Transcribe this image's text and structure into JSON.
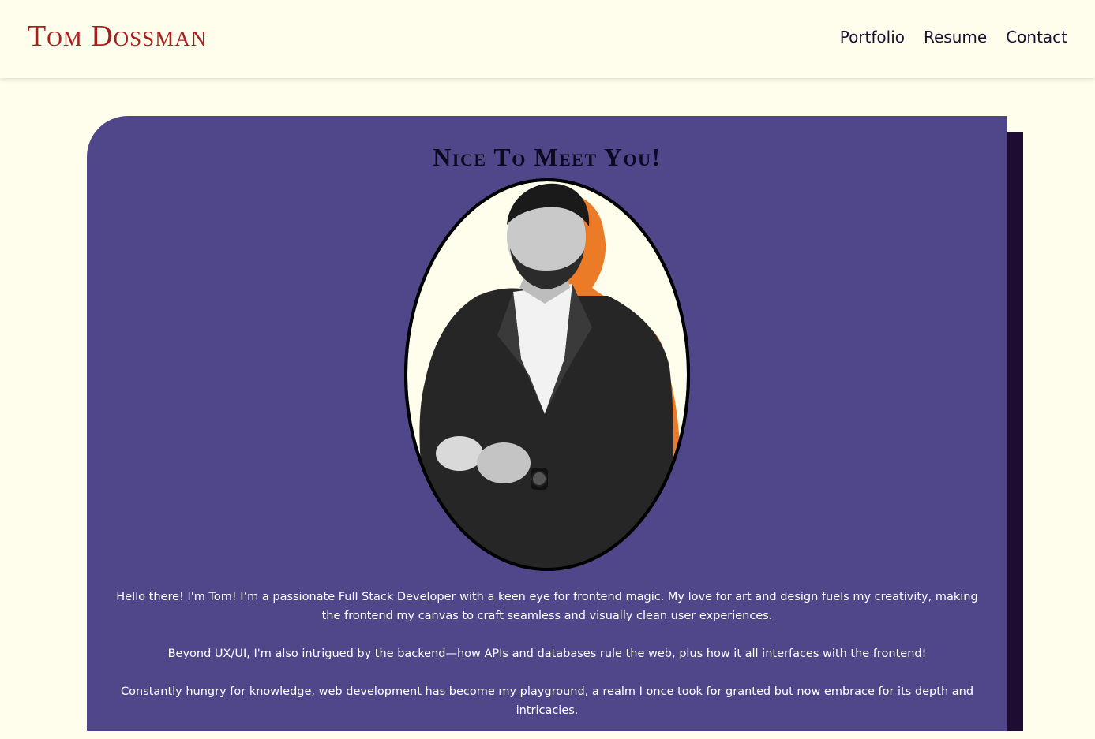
{
  "header": {
    "logo": "Tom Dossman",
    "nav": [
      "Portfolio",
      "Resume",
      "Contact"
    ]
  },
  "about": {
    "title": "Nice To Meet You!",
    "paragraphs": [
      "Hello there! I'm Tom! I’m a passionate Full Stack Developer with a keen eye for frontend magic. My love for art and design fuels my creativity, making the frontend my canvas to craft seamless and visually clean user experiences.",
      "Beyond UX/UI, I'm also intrigued by the backend—how APIs and databases rule the web, plus how it all interfaces with the frontend!",
      "Constantly hungry for knowledge, web development has become my playground, a realm I once took for granted but now embrace for its depth and intricacies."
    ]
  },
  "colors": {
    "background": "#fffdec",
    "logo": "#a81d1d",
    "card": "#50478a",
    "card_shadow": "#1e0c33",
    "portrait_accent": "#ec7b27"
  }
}
